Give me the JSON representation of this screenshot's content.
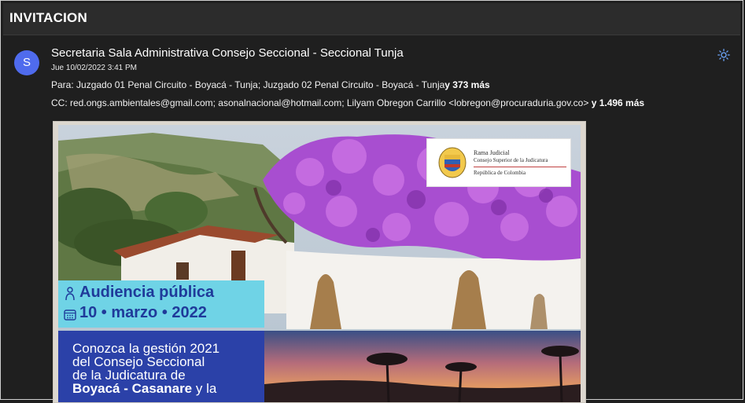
{
  "subject": "INVITACION",
  "sender": {
    "avatar_letter": "S",
    "name": "Secretaria Sala Administrativa Consejo Seccional - Seccional Tunja",
    "date": "Jue 10/02/2022 3:41 PM"
  },
  "recipients": {
    "to_label": "Para:",
    "to_list": "Juzgado 01 Penal Circuito - Boyacá - Tunja; Juzgado 02 Penal Circuito - Boyacá - Tunja",
    "to_more": "y 373 más",
    "cc_label": "CC:",
    "cc_list": "red.ongs.ambientales@gmail.com; asonalnacional@hotmail.com; Lilyam Obregon Carrillo <lobregon@procuraduria.gov.co>",
    "cc_more": "y 1.496 más"
  },
  "toolbar": {
    "theme_icon": "sun-icon"
  },
  "poster": {
    "logo_line1": "Rama Judicial",
    "logo_line2": "Consejo Superior de la Judicatura",
    "logo_line3": "República de Colombia",
    "audiencia": "Audiencia pública",
    "event_date": "10 • marzo • 2022",
    "body_line1": "Conozca la gestión 2021",
    "body_line2": "del Consejo Seccional",
    "body_line3": "de la Judicatura de",
    "body_bold": "Boyacá - Casanare",
    "body_tail": "y la"
  },
  "colors": {
    "accent": "#4f6bed",
    "background": "#1f1f1f",
    "poster_cyan": "#6fd3e6",
    "poster_blue": "#2b41a8",
    "poster_heading": "#1f3a9a"
  }
}
